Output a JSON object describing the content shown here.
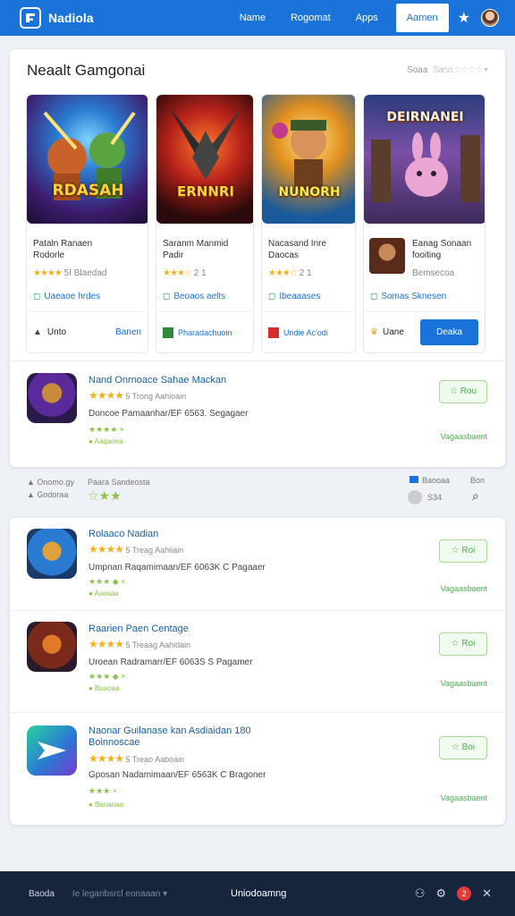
{
  "app": {
    "brand": "Nadiola"
  },
  "nav": {
    "items": [
      "Name",
      "Rogomat",
      "Apps",
      "Aamen"
    ],
    "active_index": 3
  },
  "section": {
    "title": "Neaalt Gamgonai",
    "sort_label": "Soaa",
    "sort_value": "Sarsa ☆☆☆☆ ▾"
  },
  "featured": [
    {
      "art_title": "RDASAH",
      "name": "Pataln Ranaen\nRodorle",
      "stars": "★★★★",
      "rating": "5I Blaedad",
      "tag": "Uaeaoe hrdes",
      "foot_label": "Unto",
      "foot_right": "Banen",
      "foot_icon": "mountain-icon"
    },
    {
      "art_title": "ERNNRI",
      "name": "Saranm Manmid\nPadir",
      "stars": "★★★☆",
      "rating": "2 1",
      "tag": "Beoaos aelts",
      "foot_label": "Pharadachuoin",
      "foot_right": "",
      "foot_icon": "green-square-icon"
    },
    {
      "art_title": "NUNORH",
      "name": "Nacasand Inre\nDaocas",
      "stars": "★★★☆",
      "rating": "2 1",
      "tag": "Ibeaaases",
      "foot_label": "Undie Ac'odi",
      "foot_right": "",
      "foot_icon": "red-square-icon"
    },
    {
      "art_title": "DEIRNANEI",
      "name": "Eanag Sonaan\nfooiting",
      "stars": "",
      "rating": "Bemsecoa",
      "tag": "Somas Sknesen",
      "foot_label": "Uane",
      "foot_right": "Deaka",
      "foot_icon": "crown-icon"
    }
  ],
  "top_list": [
    {
      "title": "Nand Onrnoace Sahae Mackan",
      "stars": "★★★★",
      "meta": "5 Trong   Aahioain",
      "desc": "Doncoe Pamaanhar/EF 6563. Segagaer",
      "small": "★★★★ ×",
      "small2": "● Aaqaoea",
      "button": "☆ Rou",
      "version": "Vagaasbaent"
    }
  ],
  "between": {
    "left1": "Onomo.gy",
    "left2": "Godoraa",
    "mid": "Paara Sandeosta",
    "stars": "☆★★",
    "r1": "Baooaa",
    "r2": "Bon",
    "count": "S34"
  },
  "list": [
    {
      "title": "Rolaaco Nadian",
      "stars": "★★★★",
      "meta": "5 Treag   Aahiiain",
      "desc": "Umpnan Raqamimaan/EF 6063K C Pagaaer",
      "small": "★★★ ◆ ×",
      "small2": "● Aseoaa",
      "button": "☆ Roi",
      "version": "Vagaasbaent"
    },
    {
      "title": "Raarien Paen Centage",
      "stars": "★★★★",
      "meta": "5 Treaag   Aahidain",
      "desc": "Uroean Radramarr/EF 6063S S Pagamer",
      "small": "★★★ ◆ ×",
      "small2": "● Buaoaa",
      "button": "☆ Roi",
      "version": "Vagaasbaent"
    },
    {
      "title": "Naonar Guilanase kan Asdiaidan 180\nBoinnoscae",
      "stars": "★★★★",
      "meta": "5 Treao   Aaboain",
      "desc": "Gposan Nadamimaan/EF 6563K C Bragoner",
      "small": "★★★ ×",
      "small2": "● Bananaa",
      "button": "☆ Boi",
      "version": "Vagaasbaent"
    }
  ],
  "bottom": {
    "left": "Baoda",
    "mid": "Ie leganbsrcl eonaaan ▾",
    "center": "Uniodoamng",
    "notif": "2"
  },
  "colors": {
    "primary": "#1a73d8",
    "footer": "#16243d",
    "success": "#4caf50",
    "star": "#f2b01e"
  }
}
